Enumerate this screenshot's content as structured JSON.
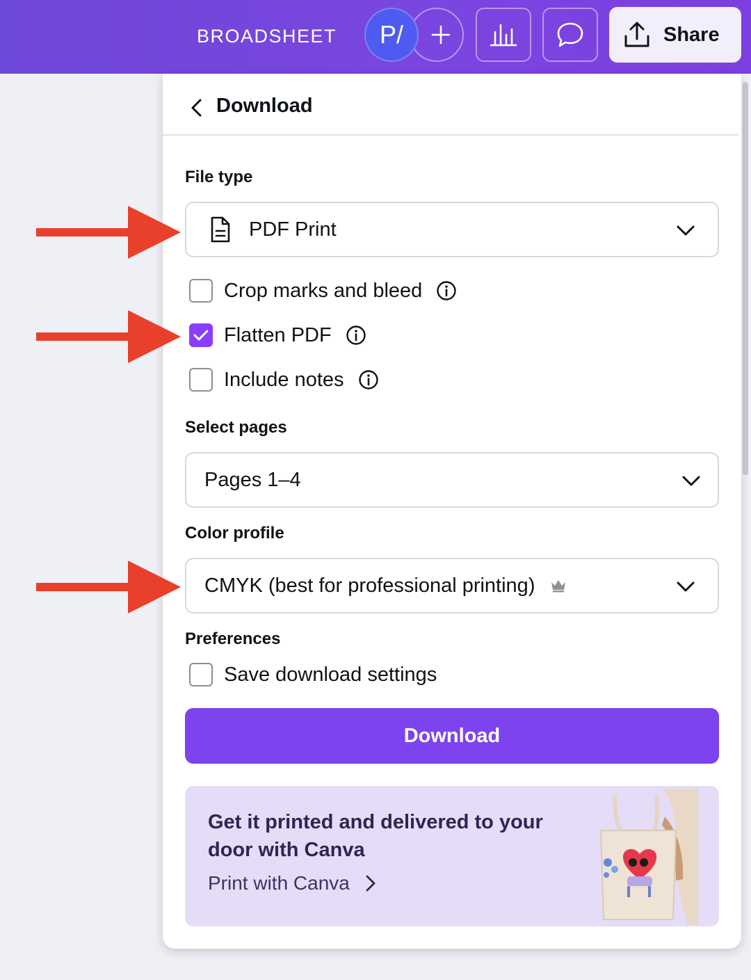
{
  "topbar": {
    "doc_title": "BROADSHEET",
    "avatar_initials": "P/",
    "add_label": "+",
    "share_label": "Share"
  },
  "panel": {
    "title": "Download",
    "file_type": {
      "label": "File type",
      "value": "PDF Print"
    },
    "options": [
      {
        "label": "Crop marks and bleed",
        "checked": false
      },
      {
        "label": "Flatten PDF",
        "checked": true
      },
      {
        "label": "Include notes",
        "checked": false
      }
    ],
    "select_pages": {
      "label": "Select pages",
      "value": "Pages 1–4"
    },
    "color_profile": {
      "label": "Color profile",
      "value": "CMYK (best for professional printing)",
      "premium_icon": "crown-icon"
    },
    "preferences": {
      "label": "Preferences",
      "save_settings": "Save download settings",
      "checked": false
    },
    "download_button": "Download",
    "promo": {
      "title": "Get it printed and delivered to your door with Canva",
      "link": "Print with Canva"
    }
  },
  "colors": {
    "accent": "#8b3dff",
    "button": "#7d43ee",
    "annotation_arrow": "#e8402a"
  }
}
